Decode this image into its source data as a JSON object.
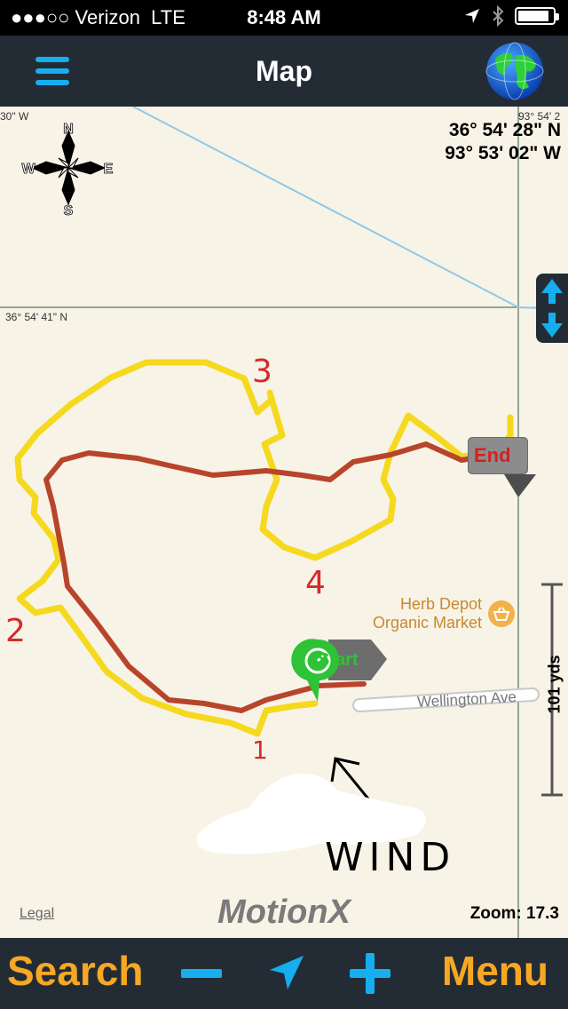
{
  "status_bar": {
    "carrier": "●●●○○ Verizon",
    "network": "LTE",
    "time": "8:48 AM",
    "battery_level": 0.9
  },
  "nav": {
    "title": "Map",
    "menu_icon": "hamburger-icon",
    "globe_icon": "globe-icon"
  },
  "map": {
    "lon_label_left": "30\" W",
    "lon_label_right": "93° 54' 2",
    "lat_label": "36° 54' 41\" N",
    "coords": {
      "lat": "36° 54' 28\" N",
      "lon": "93° 53' 02\" W"
    },
    "compass": {
      "n": "N",
      "s": "S",
      "e": "E",
      "w": "W"
    },
    "annotations": {
      "one": "1",
      "two": "2",
      "three": "3",
      "four": "4",
      "wind": "WIND"
    },
    "end_label": "End",
    "start_label": "Start",
    "poi": {
      "name_line1": "Herb Depot",
      "name_line2": "Organic Market",
      "icon": "shopping-basket-icon"
    },
    "street": "Wellington Ave",
    "scale": "101 yds",
    "legal": "Legal",
    "brand": "MotionX",
    "zoom_label": "Zoom:",
    "zoom_value": "17.3"
  },
  "toolbar": {
    "search": "Search",
    "menu": "Menu",
    "zoom_out_icon": "minus-icon",
    "zoom_in_icon": "plus-icon",
    "locate_icon": "location-arrow-icon"
  },
  "colors": {
    "toolbar_bg": "#232c35",
    "accent_blue": "#17aef0",
    "accent_orange": "#f7a823",
    "track_red": "#b8452b",
    "track_yellow": "#f4d91f",
    "annotation_red": "#d62a2a"
  }
}
